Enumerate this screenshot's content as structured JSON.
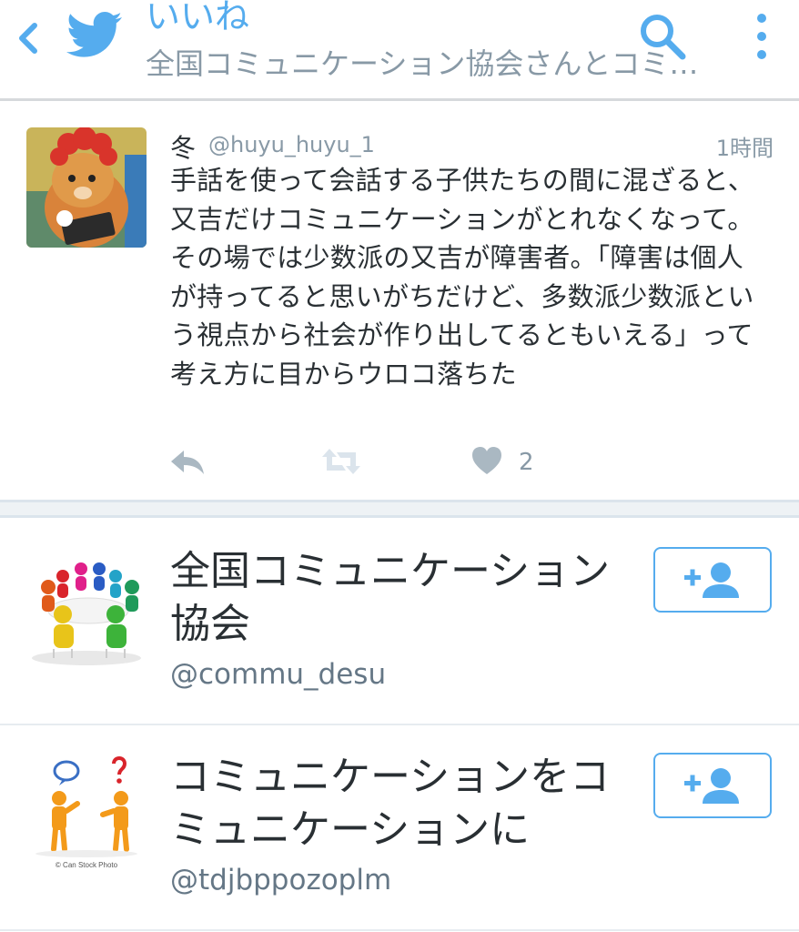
{
  "header": {
    "title": "いいね",
    "subtitle": "全国コミュニケーション協会さんとコミ…",
    "icons": [
      "back-arrow-icon",
      "twitter-bird-icon",
      "search-icon",
      "more-vertical-icon"
    ]
  },
  "tweet": {
    "name": "冬",
    "handle": "@huyu_huyu_1",
    "time": "1時間",
    "text": "手話を使って会話する子供たちの間に混ざると、又吉だけコミュニケーションがとれなくなって。その場では少数派の又吉が障害者。「障害は個人が持ってると思いがちだけど、多数派少数派という視点から社会が作り出してるともいえる」って考え方に目からウロコ落ちた",
    "like_count": "2"
  },
  "users": [
    {
      "name": "全国コミュニケーション協会",
      "handle": "@commu_desu"
    },
    {
      "name": "コミュニケーションをコミュニケーションに",
      "handle": "@tdjbppozoplm",
      "watermark": "© Can Stock Photo"
    }
  ],
  "colors": {
    "accent": "#55acee",
    "text": "#292f33",
    "muted": "#8899a6",
    "icon": "#aab8c2"
  }
}
